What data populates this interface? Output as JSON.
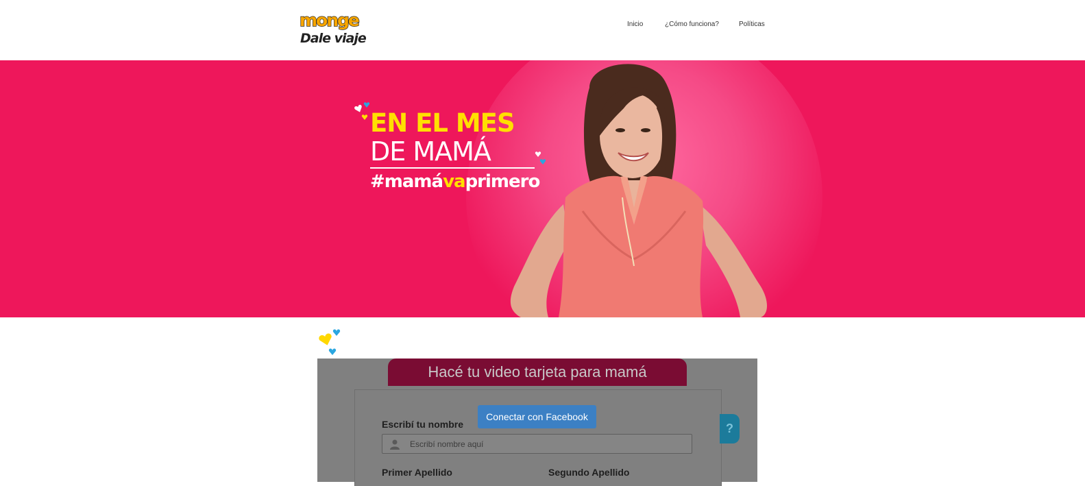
{
  "header": {
    "logo_top": "monge",
    "logo_bottom": "Dale viaje",
    "nav": [
      {
        "label": "Inicio"
      },
      {
        "label": "¿Cómo funciona?"
      },
      {
        "label": "Políticas"
      }
    ]
  },
  "hero": {
    "line1": "EN EL MES",
    "line2": "DE MAMÁ",
    "hashtag_pre": "#mamá",
    "hashtag_mid": "va",
    "hashtag_post": "primero",
    "bg_color": "#ee175b"
  },
  "form": {
    "title": "Hacé tu video tarjeta para mamá",
    "facebook_button": "Conectar con Facebook",
    "name_label": "Escribí tu nombre",
    "name_placeholder": "Escribí nombre aquí",
    "first_surname_label": "Primer Apellido",
    "second_surname_label": "Segundo Apellido",
    "help_button": "?"
  },
  "colors": {
    "hero_pink": "#ee175b",
    "accent_yellow": "#ffe000",
    "facebook_blue": "#3c80c4",
    "title_tab": "#7a0c33",
    "help_teal": "#1c7b9b"
  }
}
